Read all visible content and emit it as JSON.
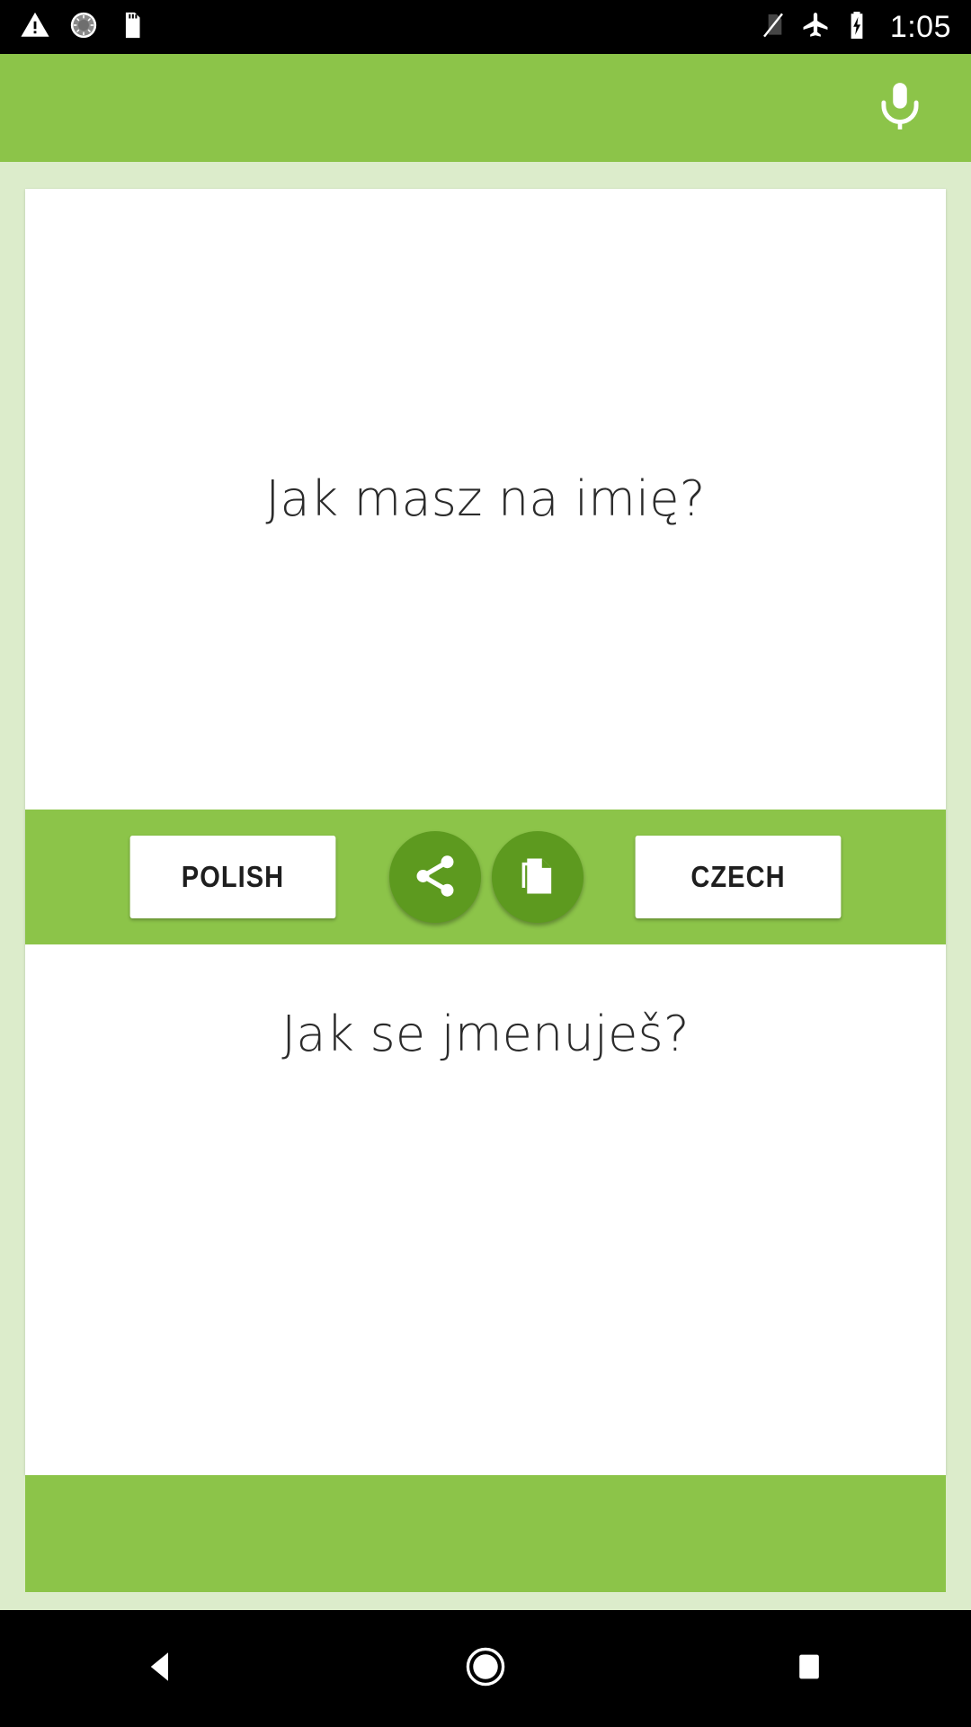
{
  "status_bar": {
    "left_icons": [
      {
        "name": "warning-triangle-icon",
        "label": "warning"
      },
      {
        "name": "sync-spinner-icon",
        "label": "sync"
      },
      {
        "name": "sd-card-icon",
        "label": "sd card"
      }
    ],
    "right_icons": [
      {
        "name": "no-sim-icon",
        "label": "no sim"
      },
      {
        "name": "airplane-mode-icon",
        "label": "airplane mode"
      },
      {
        "name": "battery-charging-icon",
        "label": "battery charging"
      }
    ],
    "clock": "1:05",
    "background": "#000000",
    "foreground": "#ffffff"
  },
  "app_bar": {
    "title": "",
    "mic_icon": "microphone-icon",
    "background": "#8cc449"
  },
  "theme": {
    "accent_green": "#8cc449",
    "deep_green": "#5d9a1f",
    "page_background": "#dceccb",
    "card_background": "#ffffff",
    "text_color": "#2b2b2b"
  },
  "translator": {
    "source": {
      "text": "Jak masz na imię?",
      "language_label": "POLISH"
    },
    "target": {
      "text": "Jak se jmenuješ?",
      "language_label": "CZECH"
    },
    "actions": [
      {
        "name": "share-button",
        "icon": "share-icon"
      },
      {
        "name": "copy-button",
        "icon": "copy-icon"
      }
    ]
  },
  "nav_bar": {
    "buttons": [
      {
        "name": "nav-back-button",
        "icon": "back-triangle-icon"
      },
      {
        "name": "nav-home-button",
        "icon": "home-circle-icon"
      },
      {
        "name": "nav-recents-button",
        "icon": "recents-square-icon"
      }
    ],
    "background": "#000000"
  }
}
